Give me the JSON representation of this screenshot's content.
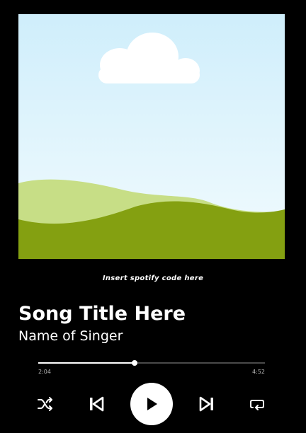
{
  "artwork": {
    "description_icon": "landscape-artwork",
    "sky_top": "#cfeefb",
    "sky_bottom": "#eef9fd",
    "hill_light": "#c7de86",
    "hill_dark": "#84a011",
    "cloud": "#ffffff"
  },
  "code_hint": "Insert spotify code here",
  "song": {
    "title": "Song Title Here",
    "singer": "Name of Singer"
  },
  "progress": {
    "elapsed": "2:04",
    "total": "4:52",
    "fraction": 0.425
  },
  "controls": {
    "shuffle_icon": "shuffle-icon",
    "previous_icon": "skip-previous-icon",
    "play_icon": "play-icon",
    "next_icon": "skip-next-icon",
    "repeat_icon": "repeat-icon"
  },
  "colors": {
    "background": "#000000",
    "foreground": "#ffffff",
    "track": "#4a4a4a",
    "muted_text": "#b3b3b3"
  }
}
